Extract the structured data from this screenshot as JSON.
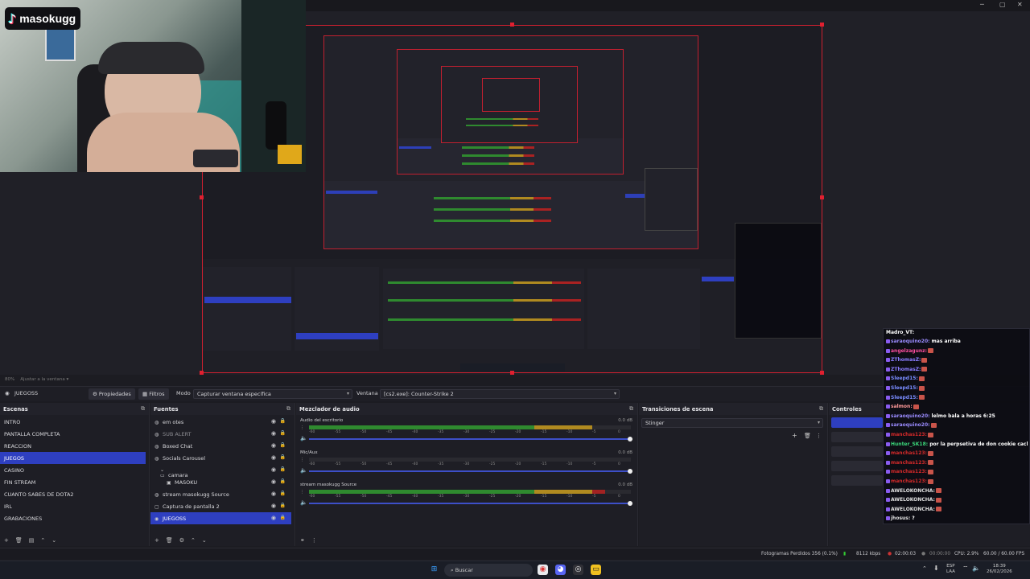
{
  "brand": {
    "name": "masokugg"
  },
  "toolbar": {
    "scene_name": "JUEGOSS",
    "properties_label": "Propiedades",
    "filters_label": "Filtros",
    "mode_label": "Modo",
    "mode_value": "Capturar ventana específica",
    "window_label": "Ventana",
    "window_value": "[cs2.exe]: Counter-Strike 2"
  },
  "zoom": {
    "level": "80%",
    "fit_label": "Ajustar a la ventana"
  },
  "scenes": {
    "title": "Escenas",
    "items": [
      {
        "label": "INTRO"
      },
      {
        "label": "PANTALLA COMPLETA"
      },
      {
        "label": "REACCION"
      },
      {
        "label": "JUEGOS",
        "selected": true
      },
      {
        "label": "CASINO"
      },
      {
        "label": "FIN STREAM"
      },
      {
        "label": "CUANTO SABES DE DOTA2"
      },
      {
        "label": "IRL"
      },
      {
        "label": "GRABACIONES"
      }
    ]
  },
  "sources": {
    "title": "Fuentes",
    "items": [
      {
        "label": "em otes",
        "icon": "browser-icon"
      },
      {
        "label": "SUB ALERT",
        "icon": "browser-icon",
        "dim": true
      },
      {
        "label": "Boxed Chat",
        "icon": "browser-icon"
      },
      {
        "label": "Socials Carousel",
        "icon": "browser-icon"
      },
      {
        "label": "camara",
        "icon": "folder-icon",
        "group": true
      },
      {
        "label": "MASOKU",
        "icon": "camera-icon",
        "child": true
      },
      {
        "label": "stream masokugg Source",
        "icon": "browser-icon"
      },
      {
        "label": "Captura de pantalla 2",
        "icon": "monitor-icon"
      },
      {
        "label": "JUEGOSS",
        "icon": "gamepad-icon",
        "selected": true
      }
    ]
  },
  "mixer": {
    "title": "Mezclador de audio",
    "ticks": [
      "-60",
      "-55",
      "-50",
      "-45",
      "-40",
      "-35",
      "-30",
      "-25",
      "-20",
      "-15",
      "-10",
      "-5",
      "0"
    ],
    "channels": [
      {
        "name": "Audio del escritorio",
        "db": "0.0 dB",
        "level": 0.88
      },
      {
        "name": "Mic/Aux",
        "db": "0.0 dB",
        "level": 0.0
      },
      {
        "name": "stream masokugg Source",
        "db": "0.0 dB",
        "level": 0.92
      }
    ]
  },
  "transitions": {
    "title": "Transiciones de escena",
    "value": "Stinger"
  },
  "controls": {
    "title": "Controles"
  },
  "status": {
    "dropped": "Fotogramas Perdidos 356 (0.1%)",
    "bitrate": "8112 kbps",
    "stream_time": "02:00:03",
    "rec_time": "00:00:00",
    "cpu": "CPU: 2.9%",
    "fps": "60.00 / 60.00 FPS"
  },
  "taskbar": {
    "search_placeholder": "Buscar",
    "lang": "ESP",
    "region": "LAA",
    "time": "18:39",
    "date": "26/02/2026"
  },
  "chat": {
    "title": "Madro_VT:",
    "messages": [
      {
        "user": "saraoquino20:",
        "text": "mas arriba",
        "color": "#9b8cff"
      },
      {
        "user": "angelzagunz:",
        "text": "",
        "color": "#ff4fa0",
        "emote": true
      },
      {
        "user": "ZThomasZ:",
        "text": "",
        "color": "#8a7dff",
        "emote": true
      },
      {
        "user": "ZThomasZ:",
        "text": "",
        "color": "#8a7dff",
        "emote": true
      },
      {
        "user": "Sleepd15:",
        "text": "",
        "color": "#7a8cff",
        "emote": true
      },
      {
        "user": "Sleepd15:",
        "text": "",
        "color": "#7a8cff",
        "emote": true
      },
      {
        "user": "Sleepd15:",
        "text": "",
        "color": "#7a8cff",
        "emote": true
      },
      {
        "user": "salmon:",
        "text": "",
        "color": "#ff9a9a",
        "emote": true
      },
      {
        "user": "saraoquino20:",
        "text": "lelmo bala a horas 6:25",
        "color": "#9b8cff"
      },
      {
        "user": "saraoquino20:",
        "text": "",
        "color": "#9b8cff",
        "emote": true
      },
      {
        "user": "manchas123:",
        "text": "",
        "color": "#d62a2a",
        "emote": true
      },
      {
        "user": "Hunter_SK18:",
        "text": "por la perpsetiva de don cookie cachoo",
        "color": "#3bd67a"
      },
      {
        "user": "manchas123:",
        "text": "",
        "color": "#d62a2a",
        "emote": true
      },
      {
        "user": "manchas123:",
        "text": "",
        "color": "#d62a2a",
        "emote": true
      },
      {
        "user": "manchas123:",
        "text": "",
        "color": "#d62a2a",
        "emote": true
      },
      {
        "user": "manchas123:",
        "text": "",
        "color": "#d62a2a",
        "emote": true
      },
      {
        "user": "AWELOKONCHA:",
        "text": "",
        "color": "#e0e0e0",
        "emote": true
      },
      {
        "user": "AWELOKONCHA:",
        "text": "",
        "color": "#e0e0e0",
        "emote": true
      },
      {
        "user": "AWELOKONCHA:",
        "text": "",
        "color": "#e0e0e0",
        "emote": true
      },
      {
        "user": "jhosus:",
        "text": "?",
        "color": "#e0e0e0"
      }
    ]
  },
  "colors": {
    "accent": "#2e3fc0",
    "selection_border": "#d02030",
    "meter_green": "#2f8a2f",
    "meter_yellow": "#b08a20",
    "meter_red": "#a22222"
  }
}
